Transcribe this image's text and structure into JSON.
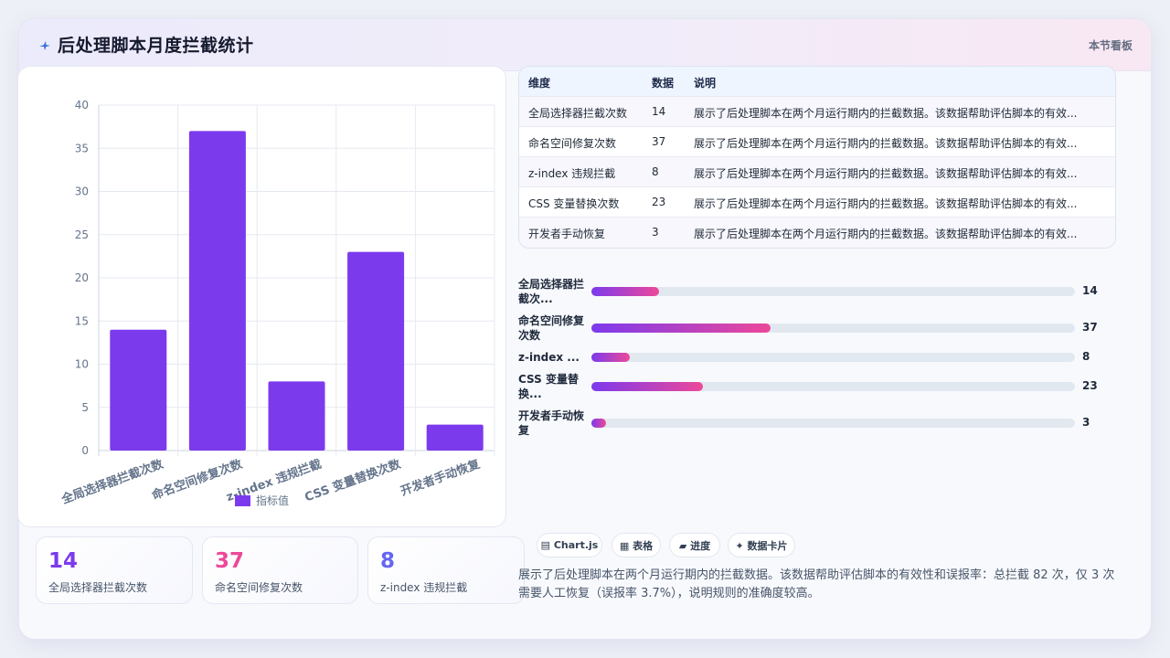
{
  "header": {
    "title": "后处理脚本月度拦截统计",
    "tag": "本节看板",
    "icon": "sparkle-icon"
  },
  "chart_data": {
    "type": "bar",
    "categories": [
      "全局选择器拦截次数",
      "命名空间修复次数",
      "z-index 违规拦截",
      "CSS 变量替换次数",
      "开发者手动恢复"
    ],
    "series": [
      {
        "name": "指标值",
        "values": [
          14,
          37,
          8,
          23,
          3
        ]
      }
    ],
    "ylim": [
      0,
      40
    ],
    "yticks": [
      0,
      5,
      10,
      15,
      20,
      25,
      30,
      35,
      40
    ],
    "grid": true,
    "legend": "bottom",
    "color": "#7c3aed"
  },
  "stats": [
    {
      "value": "14",
      "label": "全局选择器拦截次数",
      "color": "#7c3aed"
    },
    {
      "value": "37",
      "label": "命名空间修复次数",
      "color": "#ec4899"
    },
    {
      "value": "8",
      "label": "z-index 违规拦截",
      "color": "#6366f1"
    }
  ],
  "table": {
    "headers": [
      "维度",
      "数据",
      "说明"
    ],
    "rows": [
      [
        "全局选择器拦截次数",
        "14",
        "展示了后处理脚本在两个月运行期内的拦截数据。该数据帮助评估脚本的有效..."
      ],
      [
        "命名空间修复次数",
        "37",
        "展示了后处理脚本在两个月运行期内的拦截数据。该数据帮助评估脚本的有效..."
      ],
      [
        "z-index 违规拦截",
        "8",
        "展示了后处理脚本在两个月运行期内的拦截数据。该数据帮助评估脚本的有效..."
      ],
      [
        "CSS 变量替换次数",
        "23",
        "展示了后处理脚本在两个月运行期内的拦截数据。该数据帮助评估脚本的有效..."
      ],
      [
        "开发者手动恢复",
        "3",
        "展示了后处理脚本在两个月运行期内的拦截数据。该数据帮助评估脚本的有效..."
      ]
    ]
  },
  "progress": {
    "max": 100,
    "items": [
      {
        "label": "全局选择器拦截次...",
        "value": 14,
        "value_text": "14"
      },
      {
        "label": "命名空间修复次数",
        "value": 37,
        "value_text": "37"
      },
      {
        "label": "z-index ...",
        "value": 8,
        "value_text": "8"
      },
      {
        "label": "CSS 变量替换...",
        "value": 23,
        "value_text": "23"
      },
      {
        "label": "开发者手动恢复",
        "value": 3,
        "value_text": "3"
      }
    ]
  },
  "pills": [
    {
      "label": "▤ Chart.js",
      "icon": "chart-icon"
    },
    {
      "label": "▦ 表格",
      "icon": "table-icon"
    },
    {
      "label": "▰ 进度",
      "icon": "progress-icon"
    },
    {
      "label": "✦ 数据卡片",
      "icon": "card-icon"
    }
  ],
  "description": "展示了后处理脚本在两个月运行期内的拦截数据。该数据帮助评估脚本的有效性和误报率：总拦截 82 次，仅 3 次需要人工恢复（误报率 3.7%），说明规则的准确度较高。"
}
